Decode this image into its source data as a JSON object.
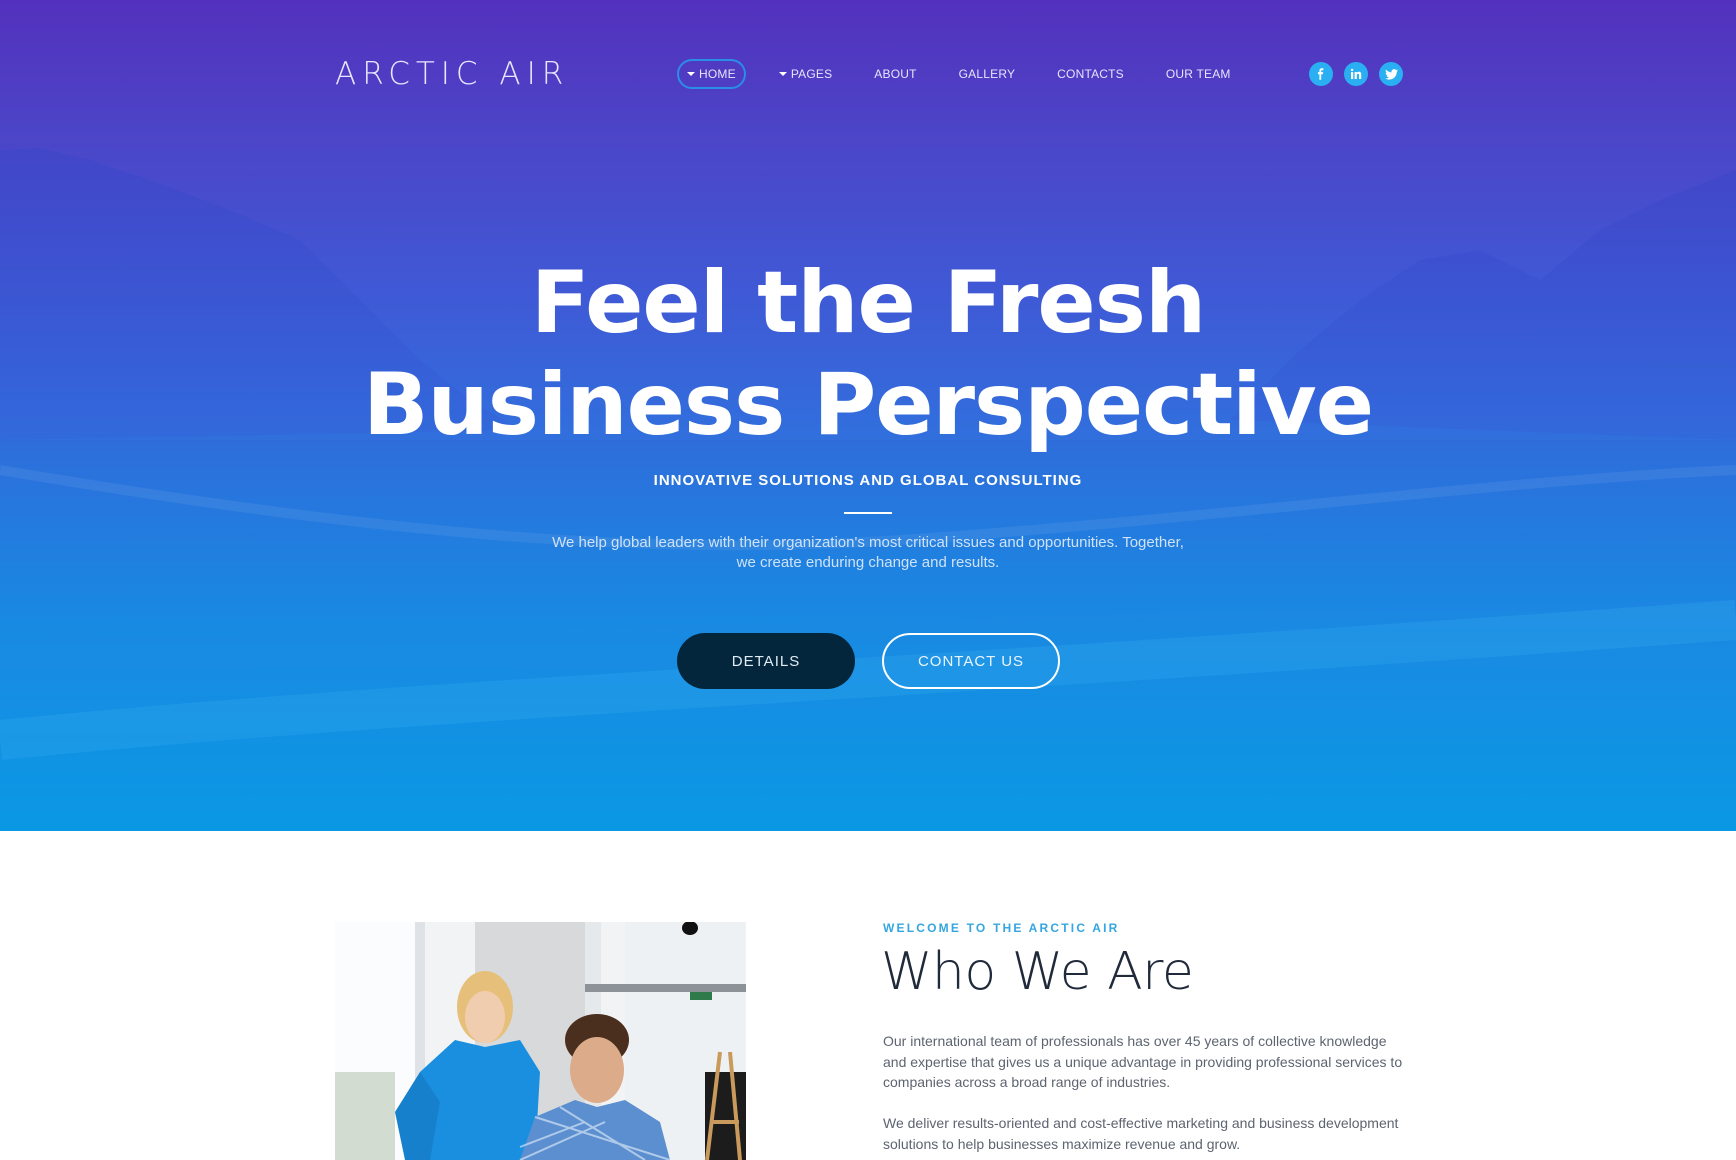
{
  "brand": {
    "logo_text": "ARCTIC AIR"
  },
  "nav": {
    "items": [
      {
        "label": "HOME",
        "has_caret": true,
        "active": true
      },
      {
        "label": "PAGES",
        "has_caret": true,
        "active": false
      },
      {
        "label": "ABOUT",
        "has_caret": false,
        "active": false
      },
      {
        "label": "GALLERY",
        "has_caret": false,
        "active": false
      },
      {
        "label": "CONTACTS",
        "has_caret": false,
        "active": false
      },
      {
        "label": "OUR TEAM",
        "has_caret": false,
        "active": false
      }
    ],
    "active_outline_color": "#2a8de8"
  },
  "social": [
    {
      "name": "facebook",
      "icon": "facebook-icon"
    },
    {
      "name": "linkedin",
      "icon": "linkedin-icon"
    },
    {
      "name": "twitter",
      "icon": "twitter-icon"
    }
  ],
  "hero": {
    "headline_line1": "Feel the Fresh",
    "headline_line2": "Business Perspective",
    "subtitle": "INNOVATIVE SOLUTIONS AND GLOBAL CONSULTING",
    "lede_line1": "We help global leaders with their organization's most critical issues and opportunities. Together,",
    "lede_line2": "we create enduring change and results.",
    "primary_button": "DETAILS",
    "secondary_button": "CONTACT US",
    "gradient_top": "#5331bd",
    "gradient_bottom": "#0a98e4"
  },
  "about": {
    "eyebrow": "WELCOME TO THE ARCTIC AIR",
    "title": "Who We Are",
    "paragraph1": "Our international team of professionals has over 45 years of collective knowledge and expertise that gives us a unique advantage in providing professional services to companies across a broad range of industries.",
    "paragraph2": "We deliver results-oriented and cost-effective marketing and business development solutions to help businesses maximize revenue and grow.",
    "accent_color": "#35a6e0"
  }
}
